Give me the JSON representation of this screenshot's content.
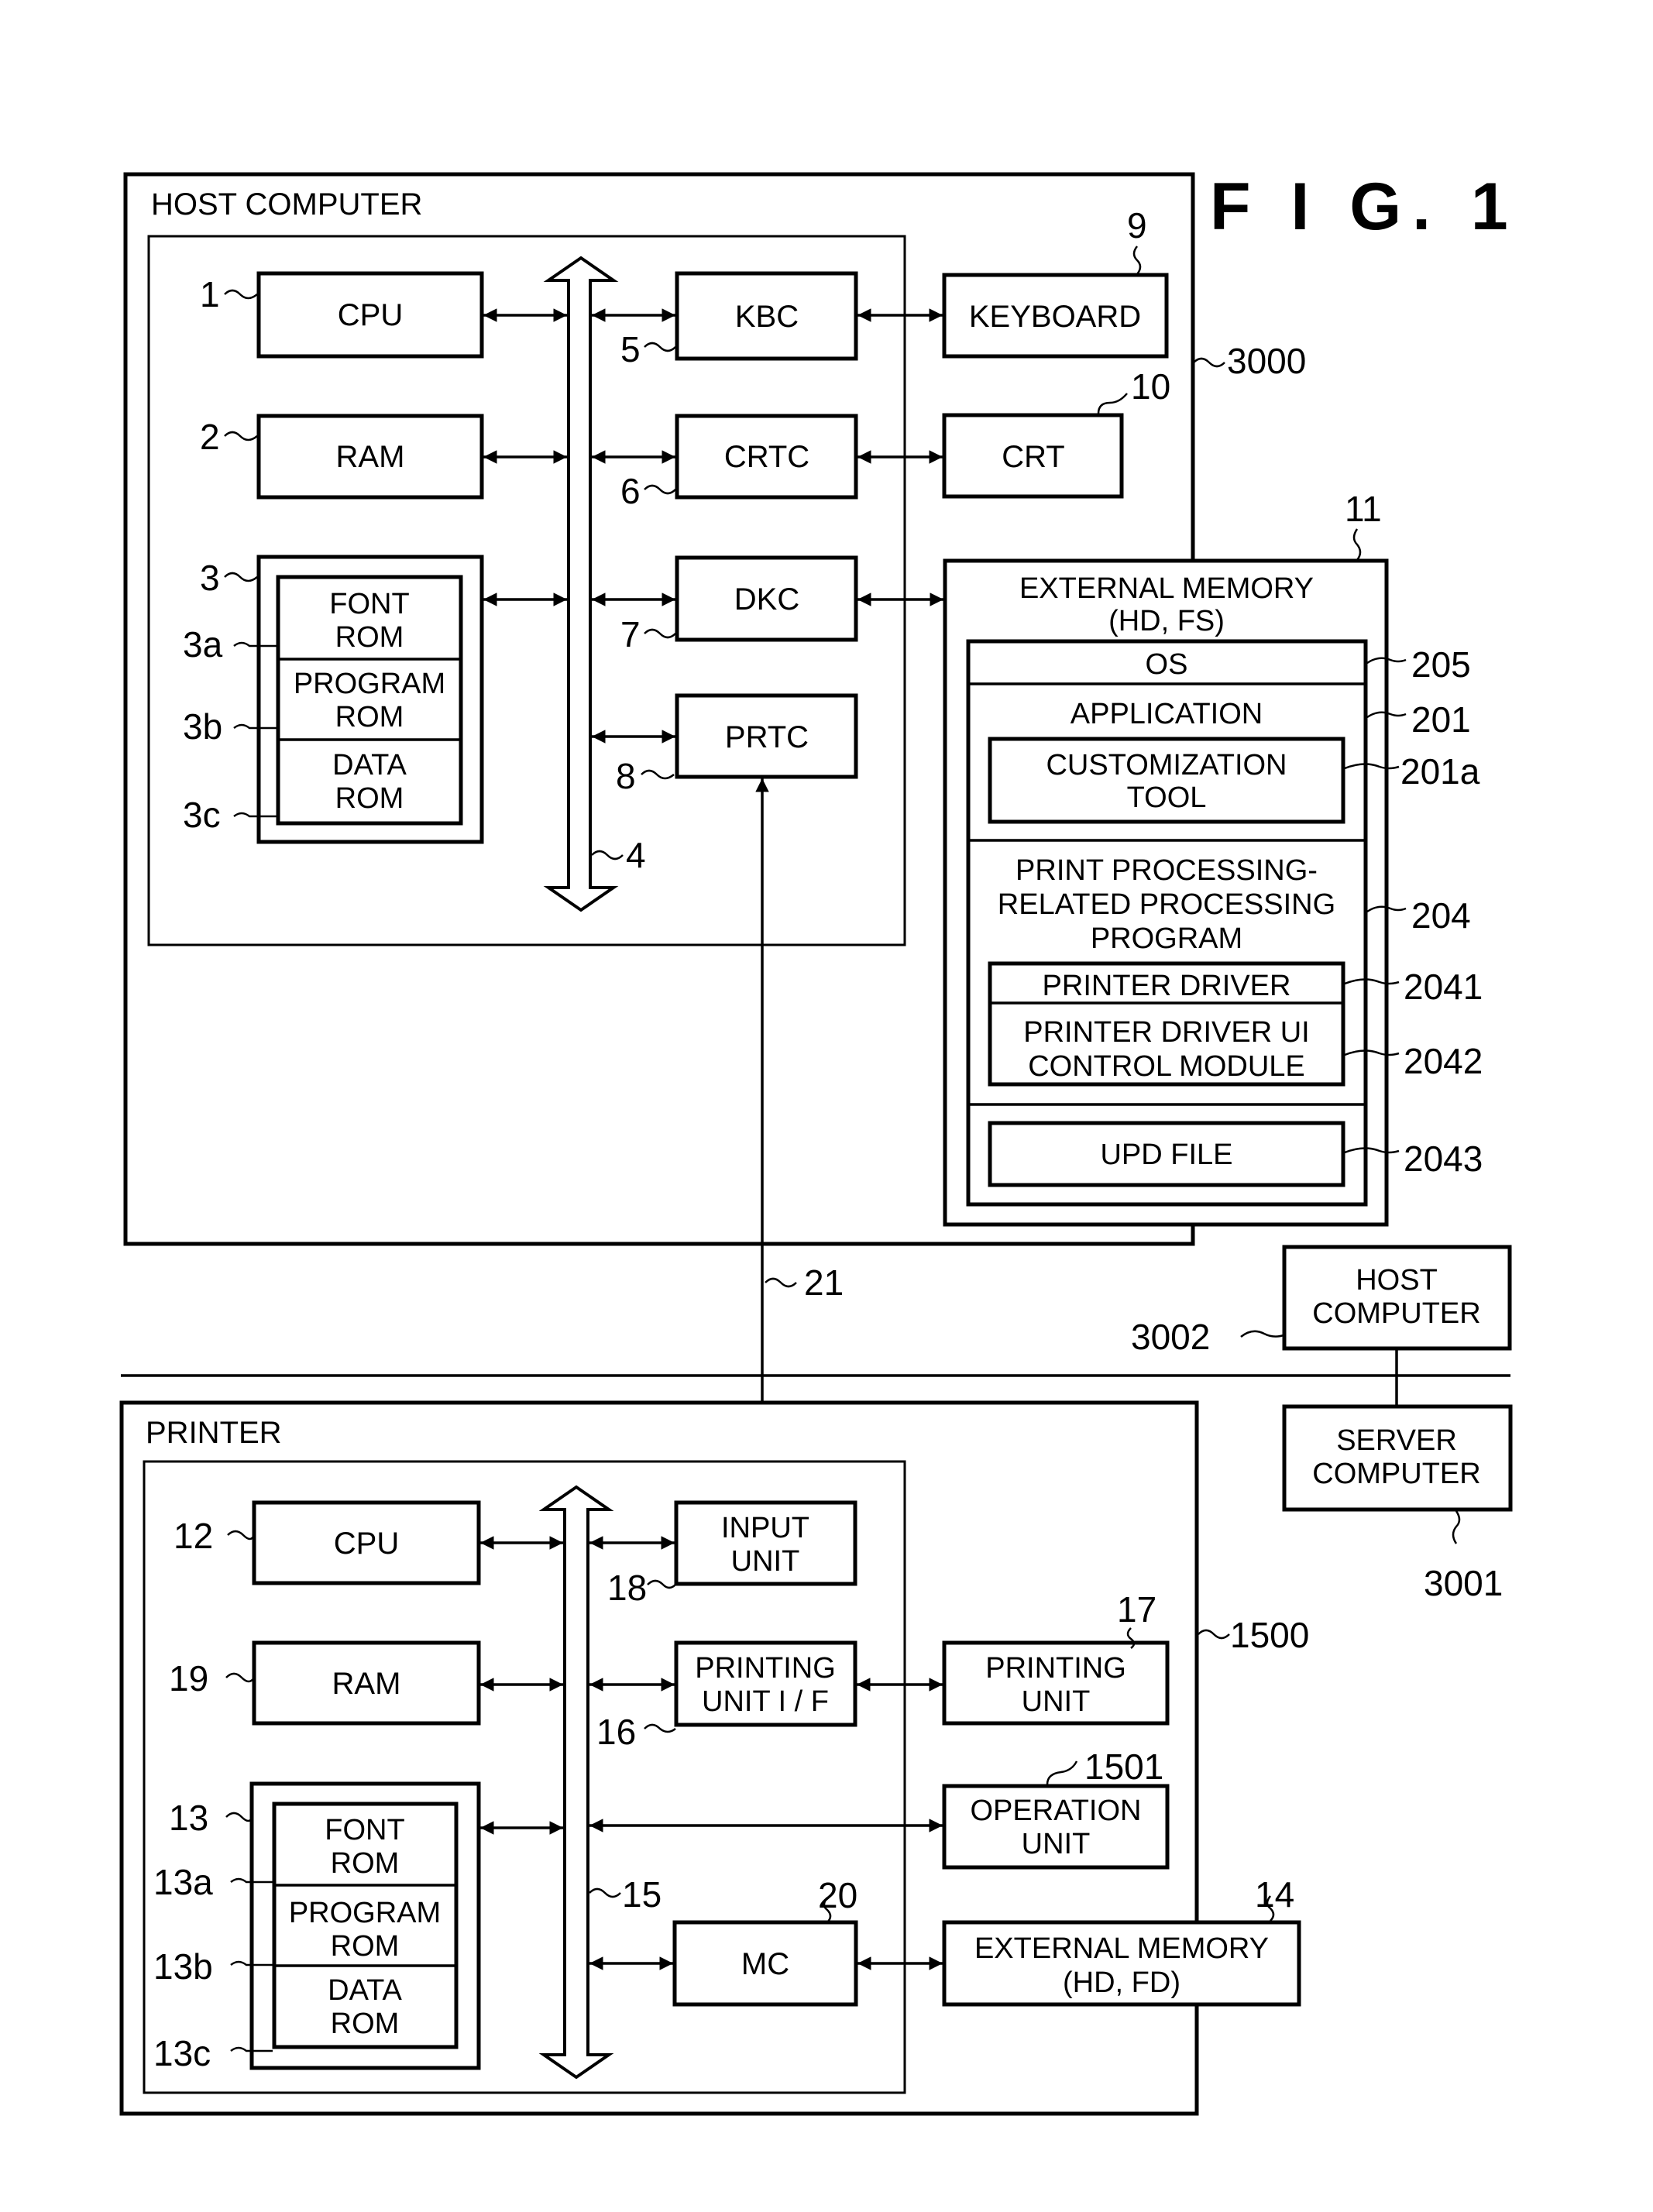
{
  "figure": {
    "title": "F I G.  1"
  },
  "host_section": {
    "title": "HOST COMPUTER",
    "ref": "3000",
    "cpu": {
      "label": "CPU",
      "ref": "1"
    },
    "ram": {
      "label": "RAM",
      "ref": "2"
    },
    "rom": {
      "ref": "3",
      "parts": [
        {
          "line1": "FONT",
          "line2": "ROM",
          "ref": "3a"
        },
        {
          "line1": "PROGRAM",
          "line2": "ROM",
          "ref": "3b"
        },
        {
          "line1": "DATA",
          "line2": "ROM",
          "ref": "3c"
        }
      ]
    },
    "bus": {
      "ref": "4"
    },
    "kbc": {
      "label": "KBC",
      "ref": "5"
    },
    "crtc": {
      "label": "CRTC",
      "ref": "6"
    },
    "dkc": {
      "label": "DKC",
      "ref": "7"
    },
    "prtc": {
      "label": "PRTC",
      "ref": "8"
    },
    "keyboard": {
      "label": "KEYBOARD",
      "ref": "9"
    },
    "crt": {
      "label": "CRT",
      "ref": "10"
    },
    "external_memory": {
      "ref": "11",
      "line1": "EXTERNAL MEMORY",
      "line2": "(HD, FS)",
      "os": {
        "label": "OS",
        "ref": "205"
      },
      "application": {
        "label": "APPLICATION",
        "ref": "201"
      },
      "customization_tool": {
        "line1": "CUSTOMIZATION",
        "line2": "TOOL",
        "ref": "201a"
      },
      "print_program": {
        "line1": "PRINT PROCESSING-",
        "line2": "RELATED PROCESSING",
        "line3": "PROGRAM",
        "ref": "204"
      },
      "printer_driver": {
        "label": "PRINTER DRIVER",
        "ref": "2041"
      },
      "ui_module": {
        "line1": "PRINTER DRIVER UI",
        "line2": "CONTROL MODULE",
        "ref": "2042"
      },
      "upd_file": {
        "label": "UPD FILE",
        "ref": "2043"
      }
    }
  },
  "connection": {
    "ref": "21"
  },
  "other_host": {
    "line1": "HOST",
    "line2": "COMPUTER",
    "ref": "3002"
  },
  "server": {
    "line1": "SERVER",
    "line2": "COMPUTER",
    "ref": "3001"
  },
  "printer_section": {
    "title": "PRINTER",
    "ref": "1500",
    "cpu": {
      "label": "CPU",
      "ref": "12"
    },
    "ram": {
      "label": "RAM",
      "ref": "19"
    },
    "rom": {
      "ref": "13",
      "parts": [
        {
          "line1": "FONT",
          "line2": "ROM",
          "ref": "13a"
        },
        {
          "line1": "PROGRAM",
          "line2": "ROM",
          "ref": "13b"
        },
        {
          "line1": "DATA",
          "line2": "ROM",
          "ref": "13c"
        }
      ]
    },
    "bus": {
      "ref": "15"
    },
    "input_unit": {
      "line1": "INPUT",
      "line2": "UNIT",
      "ref": "18"
    },
    "printing_unit_if": {
      "line1": "PRINTING",
      "line2": "UNIT I / F",
      "ref": "16"
    },
    "mc": {
      "label": "MC",
      "ref": "20"
    },
    "printing_unit": {
      "line1": "PRINTING",
      "line2": "UNIT",
      "ref": "17"
    },
    "operation_unit": {
      "line1": "OPERATION",
      "line2": "UNIT",
      "ref": "1501"
    },
    "external_memory": {
      "line1": "EXTERNAL MEMORY",
      "line2": "(HD, FD)",
      "ref": "14"
    }
  }
}
